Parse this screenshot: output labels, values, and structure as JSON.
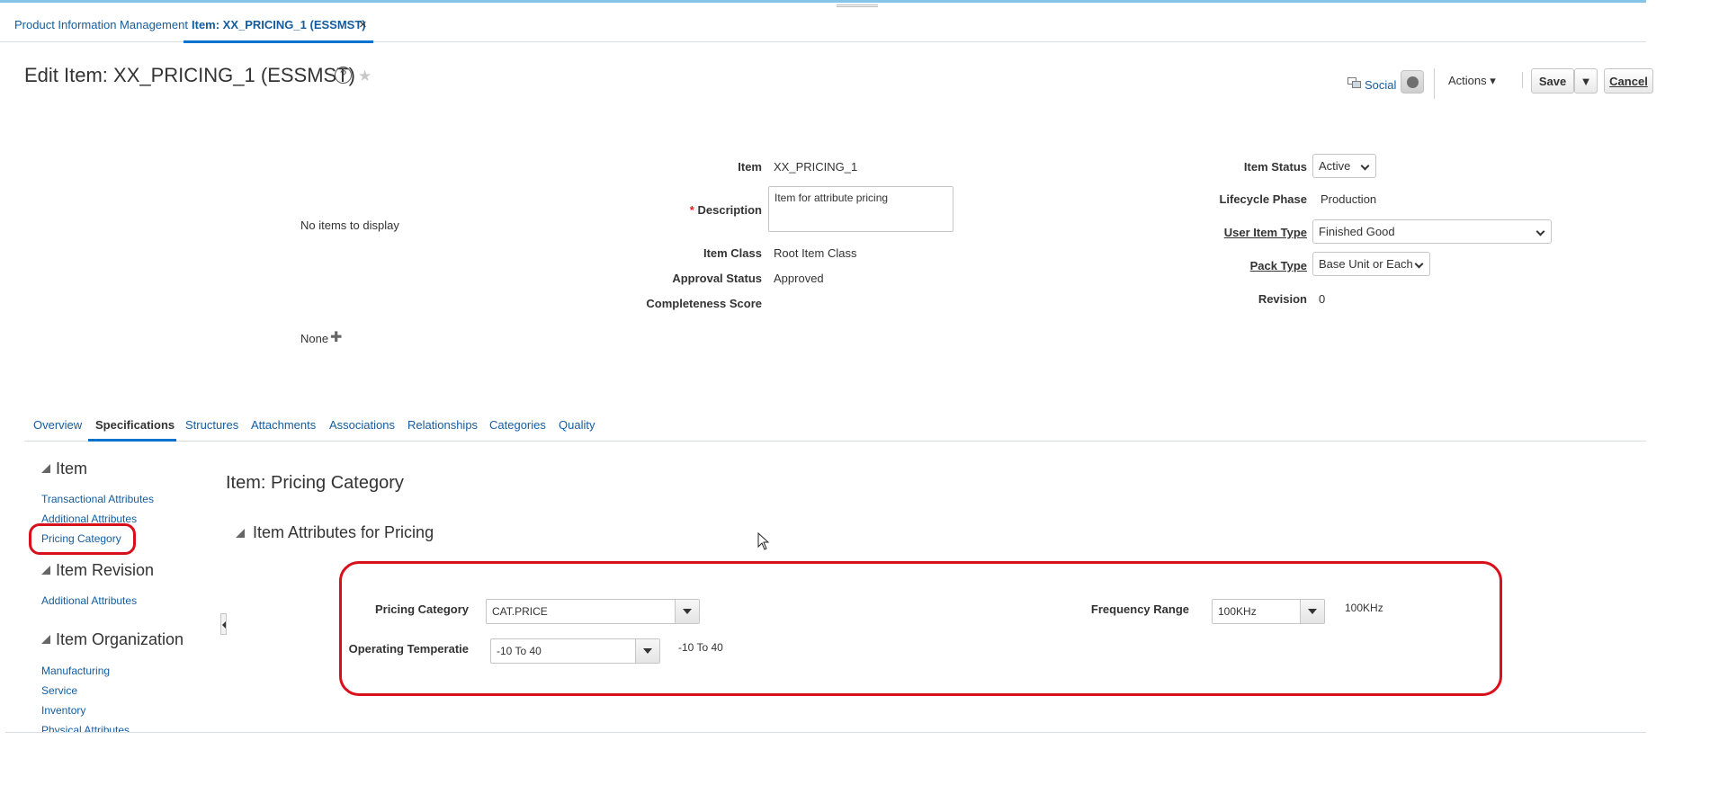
{
  "app_tabs": [
    {
      "label": "Product Information Management"
    },
    {
      "label": "Item: XX_PRICING_1 (ESSMST)"
    }
  ],
  "header": {
    "title": "Edit Item: XX_PRICING_1 (ESSMST)",
    "help_glyph": "?",
    "star_glyph": "★",
    "social_label": "Social",
    "actions_label": "Actions ▾",
    "save_label": "Save",
    "cancel_label": "Cancel"
  },
  "left_panel": {
    "no_items": "No items to display",
    "none_label": "None",
    "add_glyph": "✚"
  },
  "item_fields": {
    "item_label": "Item",
    "item_value": "XX_PRICING_1",
    "required_mark": "*",
    "description_label": "Description",
    "description_value": "Item for attribute pricing",
    "item_class_label": "Item Class",
    "item_class_value": "Root Item Class",
    "approval_label": "Approval Status",
    "approval_value": "Approved",
    "completeness_label": "Completeness Score"
  },
  "status_fields": {
    "item_status_label": "Item Status",
    "item_status_value": "Active",
    "lifecycle_label": "Lifecycle Phase",
    "lifecycle_value": "Production",
    "user_item_type_label": "User Item Type",
    "user_item_type_value": "Finished Good",
    "pack_type_label": "Pack Type",
    "pack_type_value": "Base Unit or Each",
    "revision_label": "Revision",
    "revision_value": "0"
  },
  "tabs": [
    {
      "label": "Overview"
    },
    {
      "label": "Specifications",
      "active": true
    },
    {
      "label": "Structures"
    },
    {
      "label": "Attachments"
    },
    {
      "label": "Associations"
    },
    {
      "label": "Relationships"
    },
    {
      "label": "Categories"
    },
    {
      "label": "Quality"
    }
  ],
  "sidebar": {
    "item_head": "Item",
    "item_links": [
      "Transactional Attributes",
      "Additional Attributes",
      "Pricing Category"
    ],
    "revision_head": "Item Revision",
    "revision_links": [
      "Additional Attributes"
    ],
    "org_head": "Item Organization",
    "org_links": [
      "Manufacturing",
      "Service",
      "Inventory",
      "Physical Attributes"
    ]
  },
  "content": {
    "title": "Item: Pricing Category",
    "section_title": "Item Attributes for Pricing",
    "pricing_category_label": "Pricing Category",
    "pricing_category_value": "CAT.PRICE",
    "operating_temp_label": "Operating Temperatie",
    "operating_temp_value": "-10 To 40",
    "operating_temp_display": "-10 To 40",
    "frequency_label": "Frequency Range",
    "frequency_value": "100KHz",
    "frequency_display": "100KHz"
  },
  "colors": {
    "link": "#145c9e",
    "accent": "#0572ce",
    "highlight_red": "#d8101c"
  }
}
